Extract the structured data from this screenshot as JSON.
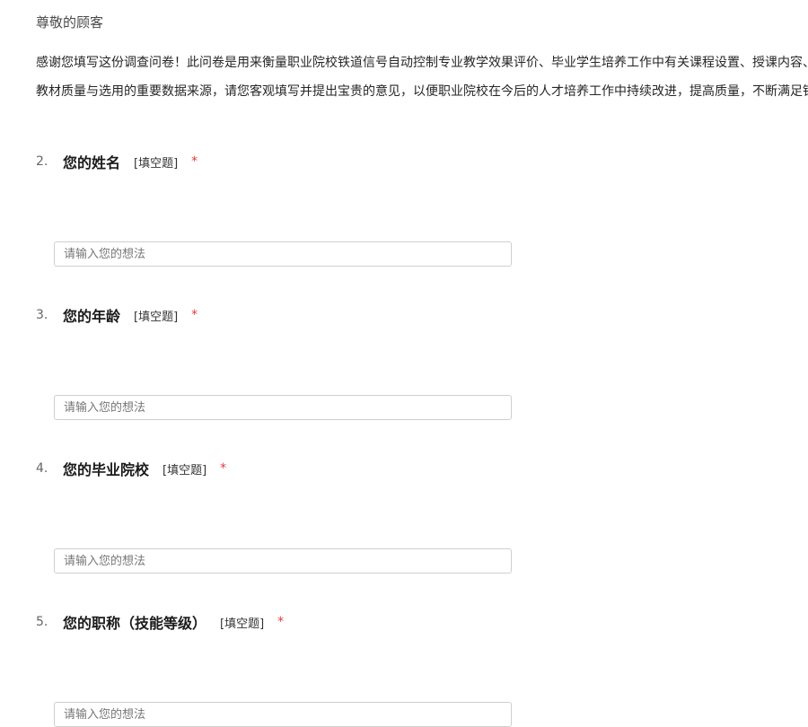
{
  "greeting": "尊敬的顾客",
  "intro": {
    "line1": "感谢您填写这份调查问卷！此问卷是用来衡量职业院校铁道信号自动控制专业教学效果评价、毕业学生培养工作中有关课程设置、授课内容、",
    "line2": "教材质量与选用的重要数据来源，请您客观填写并提出宝贵的意见，以便职业院校在今后的人才培养工作中持续改进，提高质量，不断满足铁"
  },
  "questions": [
    {
      "number": "2.",
      "title": "您的姓名",
      "type": "[填空题]",
      "required": "*",
      "placeholder": "请输入您的想法"
    },
    {
      "number": "3.",
      "title": "您的年龄",
      "type": "[填空题]",
      "required": "*",
      "placeholder": "请输入您的想法"
    },
    {
      "number": "4.",
      "title": "您的毕业院校",
      "type": "[填空题]",
      "required": "*",
      "placeholder": "请输入您的想法"
    },
    {
      "number": "5.",
      "title": "您的职称（技能等级）",
      "type": "[填空题]",
      "required": "*",
      "placeholder": "请输入您的想法"
    }
  ]
}
